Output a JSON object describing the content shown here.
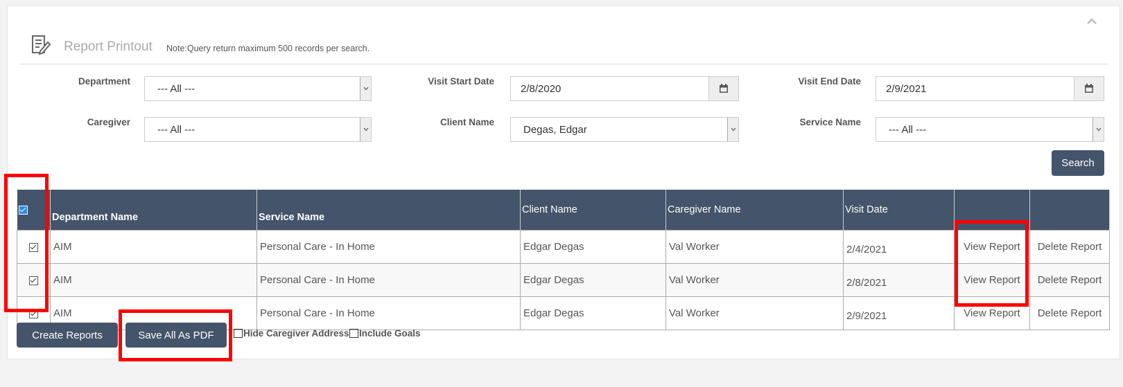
{
  "header": {
    "title": "Report Printout",
    "note": "Note:Query return maximum 500 records per search."
  },
  "filters": {
    "department": {
      "label": "Department",
      "value": "--- All ---"
    },
    "visit_start_date": {
      "label": "Visit Start Date",
      "value": "2/8/2020"
    },
    "visit_end_date": {
      "label": "Visit End Date",
      "value": "2/9/2021"
    },
    "caregiver": {
      "label": "Caregiver",
      "value": "--- All ---"
    },
    "client_name": {
      "label": "Client Name",
      "value": "Degas, Edgar"
    },
    "service_name": {
      "label": "Service Name",
      "value": "--- All ---"
    },
    "search_label": "Search"
  },
  "table": {
    "columns": [
      "Department Name",
      "Service Name",
      "Client Name",
      "Caregiver Name",
      "Visit Date",
      "",
      ""
    ],
    "rows": [
      {
        "checked": true,
        "department": "AIM",
        "service": "Personal Care - In Home",
        "client": "Edgar Degas",
        "caregiver": "Val Worker",
        "date": "2/4/2021",
        "view": "View Report",
        "delete": "Delete Report"
      },
      {
        "checked": true,
        "department": "AIM",
        "service": "Personal Care - In Home",
        "client": "Edgar Degas",
        "caregiver": "Val Worker",
        "date": "2/8/2021",
        "view": "View Report",
        "delete": "Delete Report"
      },
      {
        "checked": true,
        "department": "AIM",
        "service": "Personal Care - In Home",
        "client": "Edgar Degas",
        "caregiver": "Val Worker",
        "date": "2/9/2021",
        "view": "View Report",
        "delete": "Delete Report"
      }
    ]
  },
  "actions": {
    "create_reports": "Create Reports",
    "save_all_pdf": "Save All As PDF",
    "hide_caregiver_address": "Hide Caregiver Address",
    "include_goals": "Include Goals"
  },
  "colors": {
    "header_bg": "#44546a",
    "highlight": "#ff0000",
    "checkbox_accent": "#2e8ae6"
  },
  "icons": [
    "report-edit-icon",
    "chevron-up-icon",
    "calendar-icon",
    "dropdown-arrow-icon",
    "checkbox-icon"
  ]
}
